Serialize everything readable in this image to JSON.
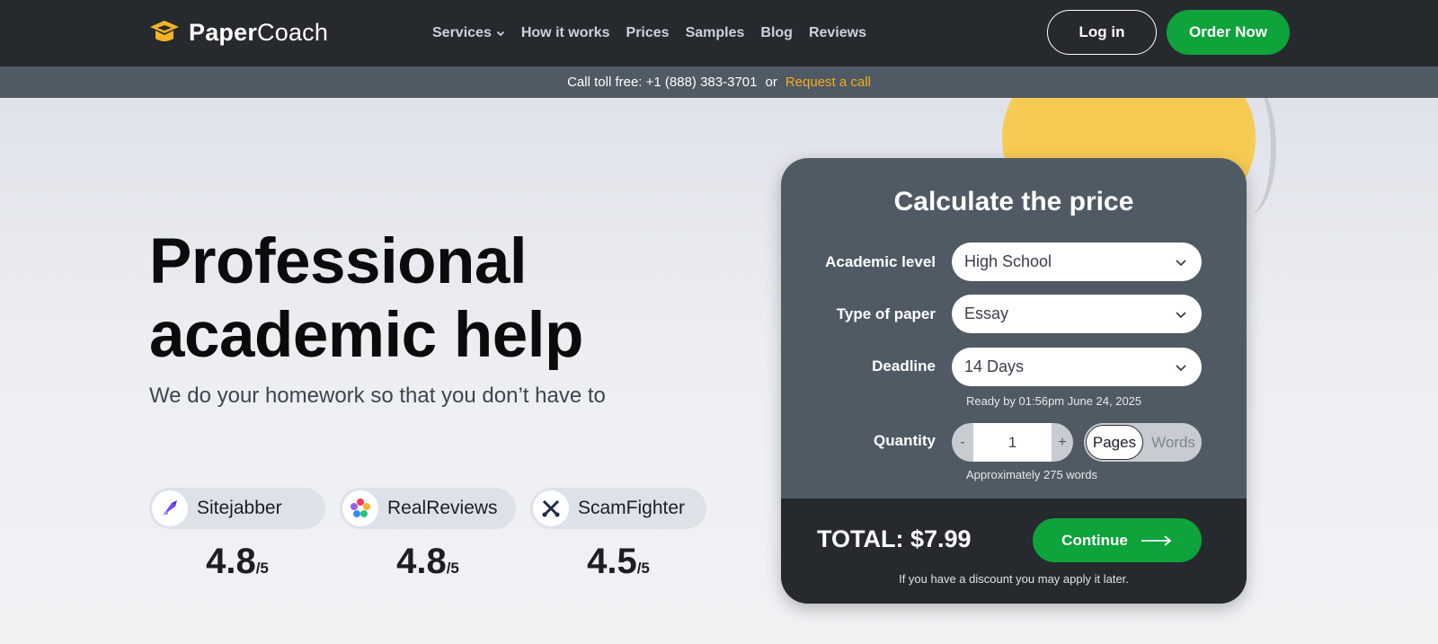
{
  "brand": {
    "name_bold": "Paper",
    "name_light": "Coach"
  },
  "nav": {
    "items": [
      {
        "label": "Services",
        "has_dropdown": true
      },
      {
        "label": "How it works"
      },
      {
        "label": "Prices"
      },
      {
        "label": "Samples"
      },
      {
        "label": "Blog"
      },
      {
        "label": "Reviews"
      }
    ]
  },
  "header": {
    "login_label": "Log in",
    "order_label": "Order Now"
  },
  "subbar": {
    "call_text": "Call toll free: +1 (888) 383-3701",
    "or_text": "or",
    "request_label": "Request a call"
  },
  "hero": {
    "title_line1": "Professional",
    "title_line2": "academic help",
    "subtitle": "We do your homework so that you don’t have to"
  },
  "reviews": [
    {
      "name": "Sitejabber",
      "icon": "sitejabber-icon",
      "score": "4.8",
      "out_of": "/5"
    },
    {
      "name": "RealReviews",
      "icon": "realreviews-icon",
      "score": "4.8",
      "out_of": "/5"
    },
    {
      "name": "ScamFighter",
      "icon": "scamfighter-icon",
      "score": "4.5",
      "out_of": "/5"
    }
  ],
  "calculator": {
    "title": "Calculate the price",
    "academic_level": {
      "label": "Academic level",
      "value": "High School"
    },
    "paper_type": {
      "label": "Type of paper",
      "value": "Essay"
    },
    "deadline": {
      "label": "Deadline",
      "value": "14 Days",
      "ready_note": "Ready by 01:56pm June 24, 2025"
    },
    "quantity": {
      "label": "Quantity",
      "minus": "-",
      "value": "1",
      "plus": "+",
      "unit_selected": "Pages",
      "unit_other": "Words",
      "approx_note": "Approximately 275 words"
    },
    "total_text": "TOTAL: $7.99",
    "continue_label": "Continue",
    "discount_note": "If you have a discount you may apply it later."
  },
  "colors": {
    "header_bg": "#262a2e",
    "subbar_bg": "#4f5a64",
    "accent_green": "#0fa33b",
    "accent_orange": "#f6ab1f",
    "logo_yellow": "#f5b323"
  }
}
